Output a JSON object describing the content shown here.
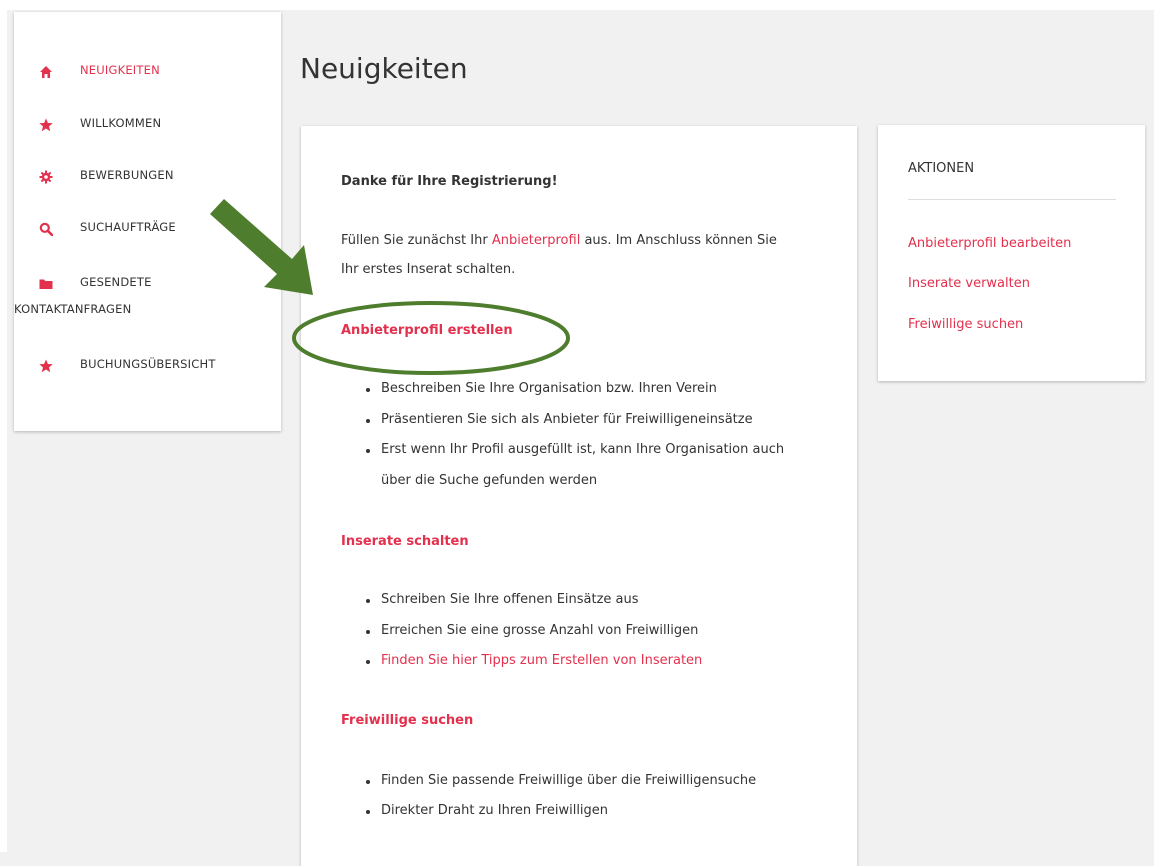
{
  "sidebar": {
    "items": [
      {
        "label": "NEUIGKEITEN",
        "icon": "home-icon",
        "active": true
      },
      {
        "label": "WILLKOMMEN",
        "icon": "star-icon"
      },
      {
        "label": "BEWERBUNGEN",
        "icon": "gear-icon"
      },
      {
        "label": "SUCHAUFTRÄGE",
        "icon": "search-icon"
      },
      {
        "label": "GESENDETE",
        "label2": "KONTAKTANFRAGEN",
        "icon": "folder-icon"
      },
      {
        "label": "BUCHUNGSÜBERSICHT",
        "icon": "star-icon"
      }
    ]
  },
  "page": {
    "title": "Neuigkeiten"
  },
  "main": {
    "heading": "Danke für Ihre Registrierung!",
    "intro_before": "Füllen Sie zunächst Ihr ",
    "intro_link": "Anbieterprofil",
    "intro_after": " aus. Im Anschluss können Sie",
    "intro_line2": "Ihr erstes Inserat schalten.",
    "sections": [
      {
        "title": "Anbieterprofil erstellen",
        "bullets": [
          "Beschreiben Sie Ihre Organisation bzw. Ihren Verein",
          "Präsentieren Sie sich als Anbieter für Freiwilligeneinsätze",
          "Erst wenn Ihr Profil ausgefüllt ist, kann Ihre Organisation auch",
          "über die Suche gefunden werden"
        ]
      },
      {
        "title": "Inserate schalten",
        "bullets": [
          "Schreiben Sie Ihre offenen Einsätze aus",
          "Erreichen Sie eine grosse Anzahl von Freiwilligen",
          "Finden Sie hier Tipps zum Erstellen von Inseraten"
        ]
      },
      {
        "title": "Freiwillige suchen",
        "bullets": [
          "Finden Sie passende Freiwillige über die Freiwilligensuche",
          "Direkter Draht zu Ihren Freiwilligen"
        ]
      }
    ]
  },
  "actions": {
    "title": "AKTIONEN",
    "links": [
      "Anbieterprofil bearbeiten",
      "Inserate verwalten",
      "Freiwillige suchen"
    ]
  },
  "colors": {
    "accent": "#e3304d",
    "annotation": "#4e7d2e",
    "text": "#333333"
  }
}
